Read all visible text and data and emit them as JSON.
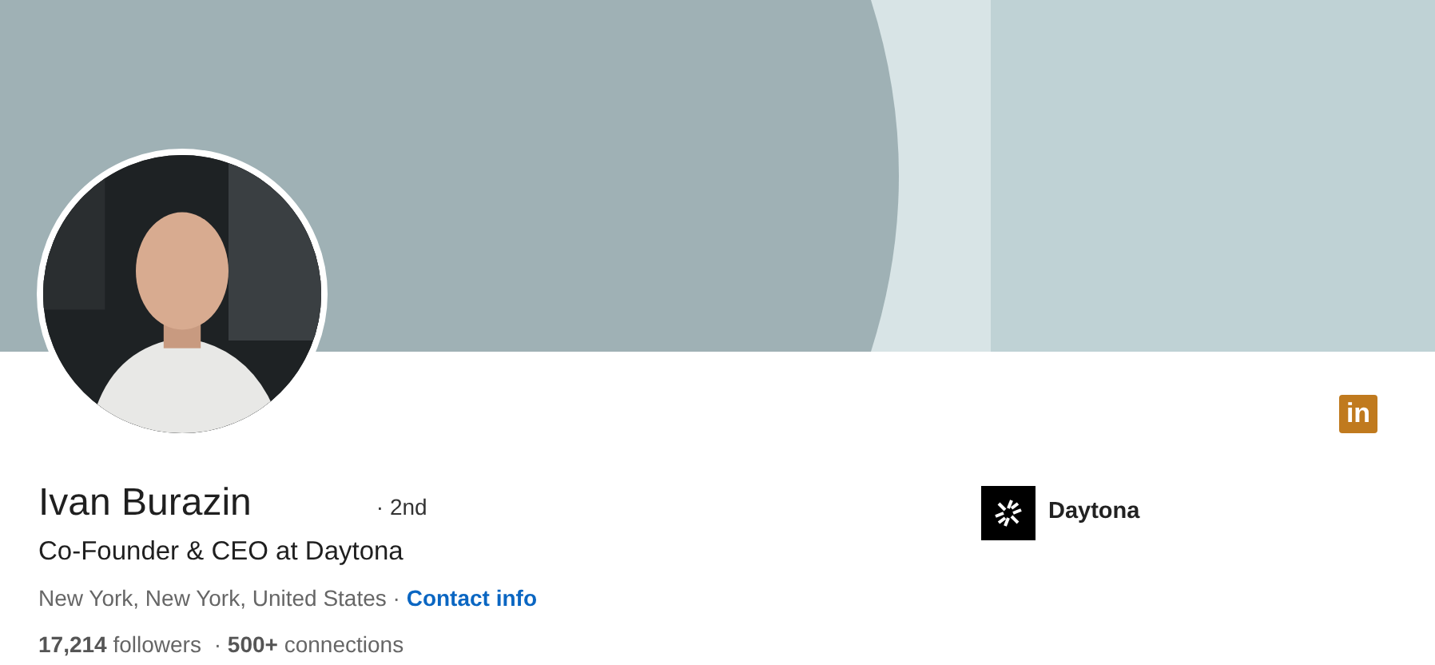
{
  "brand_badge": {
    "text": "in"
  },
  "profile": {
    "name": "Ivan Burazin",
    "degree": "· 2nd",
    "headline": "Co-Founder & CEO at Daytona",
    "location": "New York, New York, United States ·",
    "contact_link": "Contact info",
    "followers": "**17,214** followers",
    "connections": "· **500+** connections"
  },
  "company": {
    "name": "Daytona"
  }
}
